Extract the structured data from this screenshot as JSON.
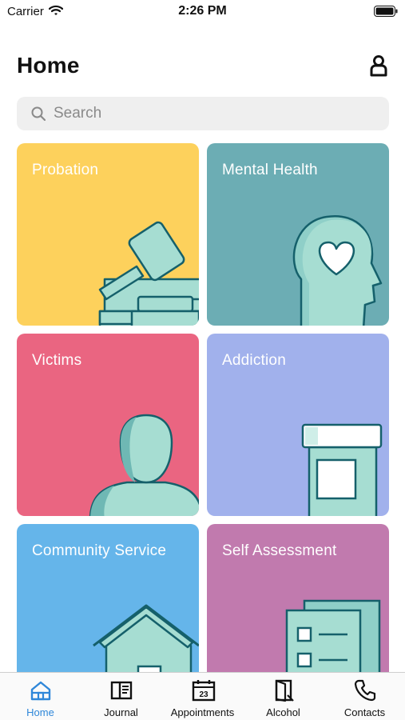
{
  "status_bar": {
    "carrier": "Carrier",
    "time": "2:26 PM"
  },
  "header": {
    "title": "Home"
  },
  "search": {
    "placeholder": "Search"
  },
  "tiles": [
    {
      "label": "Probation",
      "color": "#fdd15c",
      "icon": "gavel-icon"
    },
    {
      "label": "Mental Health",
      "color": "#6cadb4",
      "icon": "head-heart-icon"
    },
    {
      "label": "Victims",
      "color": "#ea6581",
      "icon": "person-icon"
    },
    {
      "label": "Addiction",
      "color": "#a1b1ec",
      "icon": "pill-bottle-icon"
    },
    {
      "label": "Community Service",
      "color": "#65b5ea",
      "icon": "house-icon"
    },
    {
      "label": "Self Assessment",
      "color": "#c17aae",
      "icon": "checklist-icon"
    }
  ],
  "tabs": [
    {
      "label": "Home",
      "icon": "home-icon",
      "active": true
    },
    {
      "label": "Journal",
      "icon": "journal-icon",
      "active": false
    },
    {
      "label": "Appointments",
      "icon": "calendar-icon",
      "calendar_day": "23",
      "active": false
    },
    {
      "label": "Alcohol",
      "icon": "door-icon",
      "active": false
    },
    {
      "label": "Contacts",
      "icon": "phone-icon",
      "active": false
    }
  ],
  "colors": {
    "accent": "#2f87d9",
    "illustration_fill": "#a6ddd2",
    "illustration_stroke": "#15606b"
  }
}
